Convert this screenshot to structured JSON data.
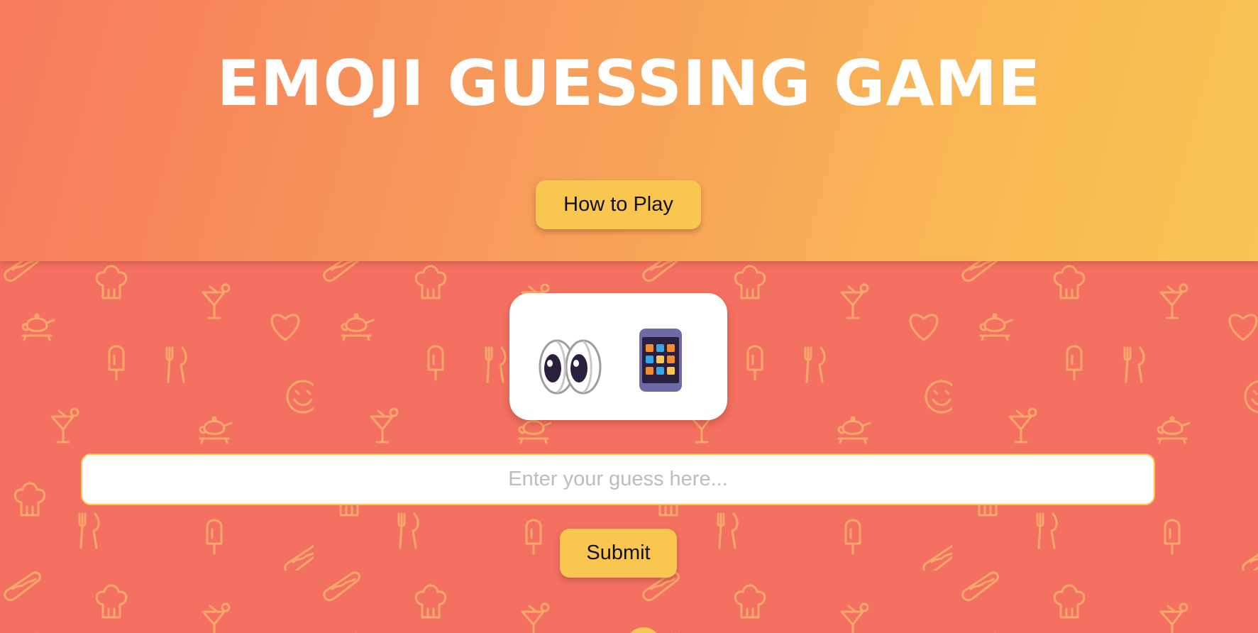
{
  "header": {
    "title": "EMOJI GUESSING GAME",
    "how_to_play_label": "How to Play"
  },
  "puzzle": {
    "emojis": [
      "eyes-emoji",
      "phone-emoji"
    ]
  },
  "guess": {
    "placeholder": "Enter your guess here...",
    "value": ""
  },
  "submit_label": "Submit",
  "colors": {
    "background": "#f47060",
    "pattern_stroke": "#f9a86a",
    "header_gradient_start": "#f77b5c",
    "header_gradient_end": "#fac553",
    "button": "#f9c74f",
    "input_border": "#f9c74f"
  },
  "background_pattern_icons": [
    "chef-hat-icon",
    "teapot-icon",
    "cocktail-icon",
    "heart-icon",
    "popsicle-icon",
    "fork-knife-icon",
    "smiley-icon",
    "hotdog-icon"
  ]
}
